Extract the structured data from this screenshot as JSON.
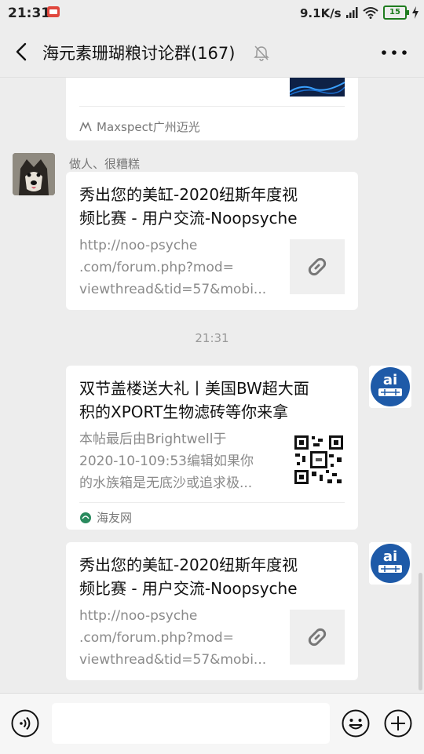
{
  "status": {
    "time": "21:31",
    "speed": "9.1K/s",
    "battery": "15"
  },
  "header": {
    "title": "海元素珊瑚粮讨论群(167)"
  },
  "messages": {
    "m0": {
      "source": "Maxspect广州迈光"
    },
    "m1": {
      "sender": "做人、很糟糕",
      "title_line1": "秀出您的美缸-2020纽斯年度视",
      "title_line2": "频比赛 - 用户交流-Noopsyche",
      "desc_line1": "http://noo-psyche",
      "desc_line2": ".com/forum.php?mod=",
      "desc_line3": "viewthread&tid=57&mobi..."
    },
    "timestamp": "21:31",
    "m2": {
      "title_line1": "双节盖楼送大礼丨美国BW超大面",
      "title_line2": "积的XPORT生物滤砖等你来拿",
      "desc_line1": "本帖最后由Brightwell于",
      "desc_line2": "2020-10-109:53编辑如果你",
      "desc_line3": "的水族箱是无底沙或追求极...",
      "source": "海友网"
    },
    "m3": {
      "title_line1": "秀出您的美缸-2020纽斯年度视",
      "title_line2": "频比赛 - 用户交流-Noopsyche",
      "desc_line1": "http://noo-psyche",
      "desc_line2": ".com/forum.php?mod=",
      "desc_line3": "viewthread&tid=57&mobi..."
    }
  },
  "avatar_labels": {
    "ai_text": "ai"
  },
  "colors": {
    "background": "#ededed",
    "card": "#ffffff",
    "avatar_blue": "#1e5aa8",
    "battery": "#1f7c1f"
  }
}
